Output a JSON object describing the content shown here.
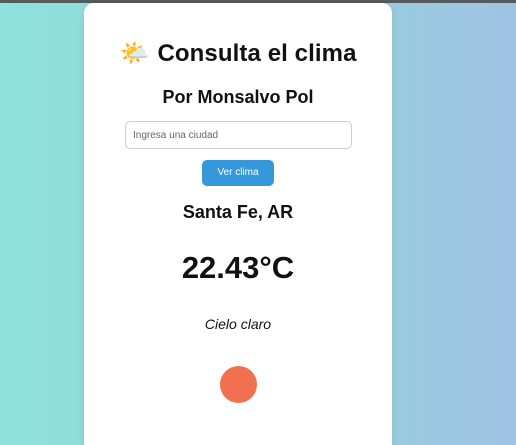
{
  "header": {
    "icon": "sun-behind-cloud-icon",
    "icon_glyph": "🌤️",
    "title": "Consulta el clima",
    "subtitle": "Por Monsalvo Pol"
  },
  "search": {
    "placeholder": "Ingresa una ciudad",
    "value": "",
    "button_label": "Ver clima"
  },
  "weather": {
    "location": "Santa Fe, AR",
    "temperature": "22.43°C",
    "description": "Cielo claro",
    "indicator_icon": "status-dot-icon"
  },
  "colors": {
    "accent": "#3498db",
    "indicator": "#f07050",
    "background_left": "#8ee1dc",
    "background_right": "#9fc3e3",
    "card": "#ffffff"
  }
}
